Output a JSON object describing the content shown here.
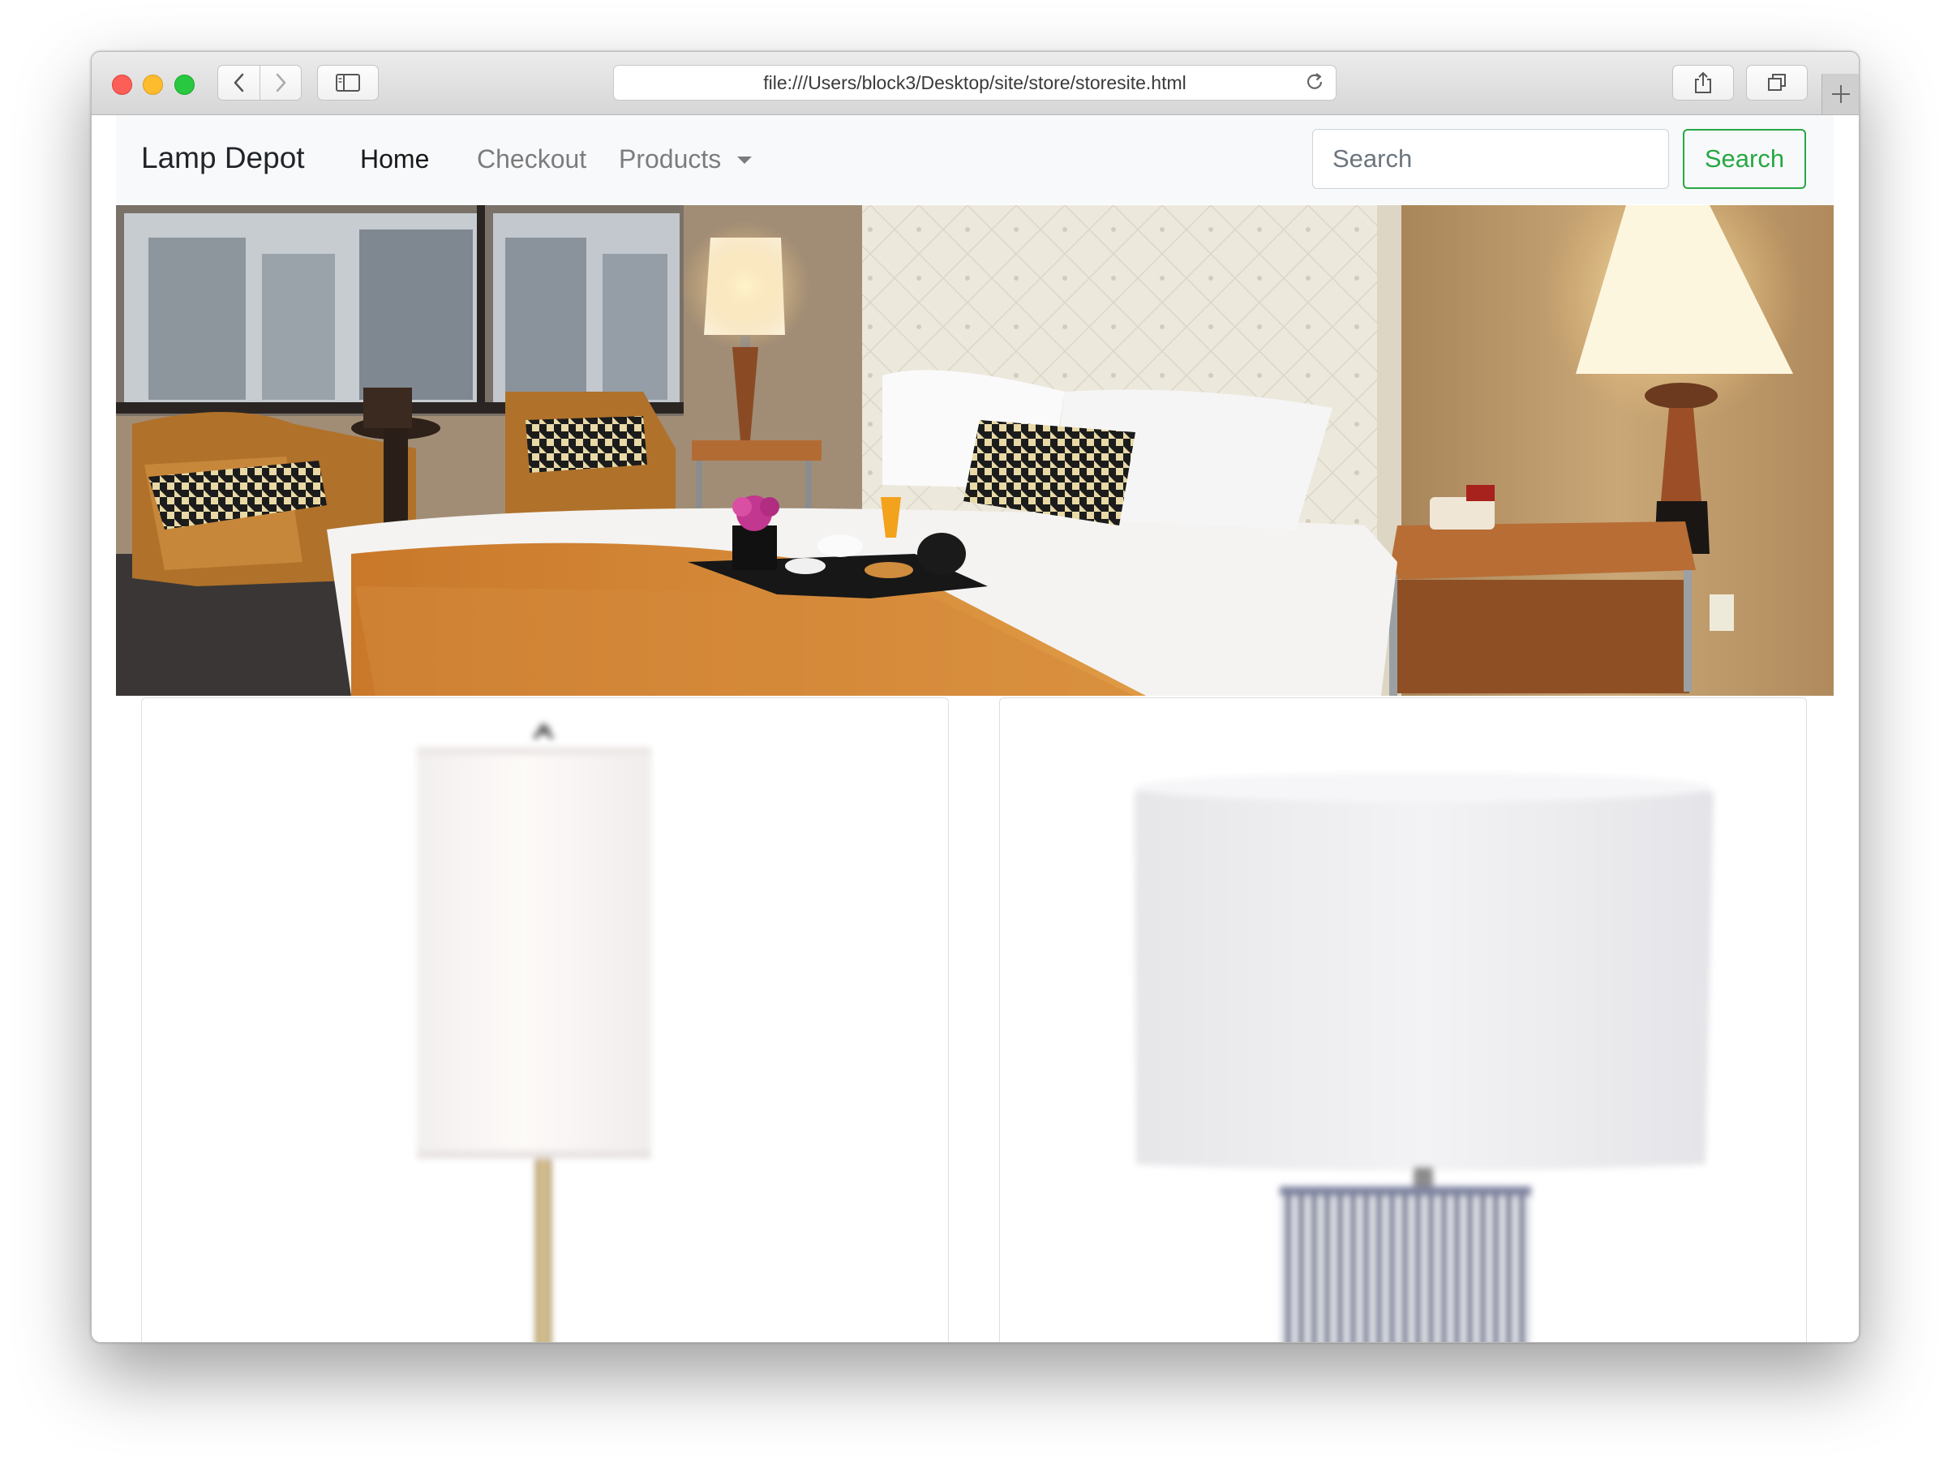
{
  "browser": {
    "url": "file:///Users/block3/Desktop/site/store/storesite.html"
  },
  "navbar": {
    "brand": "Lamp Depot",
    "links": [
      {
        "label": "Home",
        "active": true
      },
      {
        "label": "Checkout",
        "active": false
      },
      {
        "label": "Products",
        "active": false,
        "dropdown": true
      }
    ],
    "search_placeholder": "Search",
    "search_button": "Search"
  },
  "colors": {
    "navbar_bg": "#f8f9fa",
    "search_button": "#28a745"
  }
}
